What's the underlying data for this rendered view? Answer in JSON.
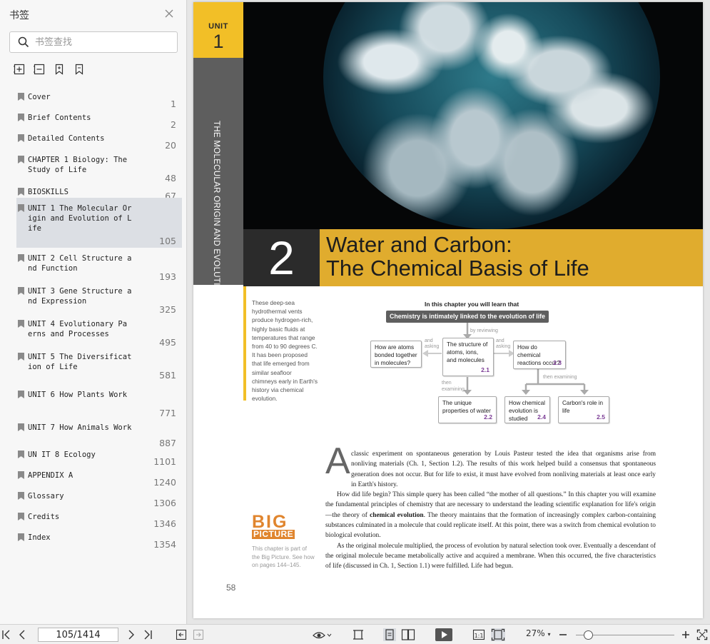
{
  "sidebar": {
    "title": "书签",
    "search_placeholder": "书签查找",
    "bookmarks": [
      {
        "label": "Cover",
        "page": "1"
      },
      {
        "label": "Brief Contents",
        "page": "2"
      },
      {
        "label": "Detailed Contents",
        "page": "20"
      },
      {
        "label": "CHAPTER 1 Biology: The Study of Life",
        "page": "48"
      },
      {
        "label": "BIOSKILLS",
        "page": "67"
      },
      {
        "label": "UNIT 1 The Molecular Origin and Evolution of Life",
        "page": "105"
      },
      {
        "label": "UNIT 2 Cell Structure and Function",
        "page": "193"
      },
      {
        "label": "UNIT 3 Gene Structure and Expression",
        "page": "325"
      },
      {
        "label": "UNIT 4 Evolutionary Pa erns and Processes",
        "page": "495"
      },
      {
        "label": "UNIT 5 The Diversification of Life",
        "page": "581"
      },
      {
        "label": "UNIT 6 How Plants Work",
        "page": "771"
      },
      {
        "label": "UNIT 7 How Animals Work",
        "page": "887"
      },
      {
        "label": "UN IT 8 Ecology",
        "page": "1101"
      },
      {
        "label": "APPENDIX A",
        "page": "1240"
      },
      {
        "label": "Glossary",
        "page": "1306"
      },
      {
        "label": "Credits",
        "page": "1346"
      },
      {
        "label": "Index",
        "page": "1354"
      }
    ]
  },
  "doc": {
    "unit_word": "UNIT",
    "unit_num": "1",
    "unit_strip": "THE MOLECULAR ORIGIN AND EVOLUTION OF LIFE",
    "chapter_num": "2",
    "title_line1": "Water and Carbon:",
    "title_line2": "The Chemical Basis of Life",
    "caption": "These deep-sea hydrothermal vents produce hydrogen-rich, highly basic fluids at temperatures that range from 40 to 90 degrees C. It has been proposed that life emerged from similar seafloor chimneys early in Earth's history via chemical evolution.",
    "concept_map": {
      "heading": "In this chapter you will learn that",
      "main": "Chemistry is intimately linked to the evolution of life",
      "by_reviewing": "by reviewing",
      "and_asking": "and asking",
      "then_examining": "then examining",
      "then": "then",
      "examining": "examining",
      "box_atoms": "How are atoms bonded together in molecules?",
      "box_structure": "The structure of atoms, ions, and molecules",
      "sec_21": "2.1",
      "box_reactions": "How do chemical reactions occur?",
      "sec_23": "2.3",
      "box_water": "The unique properties of water",
      "sec_22": "2.2",
      "box_evolution": "How chemical evolution is studied",
      "sec_24": "2.4",
      "box_carbon": "Carbon's role in life",
      "sec_25": "2.5"
    },
    "big_picture": {
      "big": "BIG",
      "picture": "PICTURE",
      "note": "This chapter is part of the Big Picture. See how on pages 144–145."
    },
    "dropcap": "A",
    "para1": "classic experiment on spontaneous generation by Louis Pasteur tested the idea that organisms arise from nonliving materials (Ch. 1, Section 1.2). The results of this work helped build a consensus that spontaneous generation does not occur. But for life to exist, it must have evolved from nonliving materials at least once early in Earth's history.",
    "para2a": "How did life begin? This simple query has been called “the mother of all questions.” In this chapter you will examine the fundamental principles of chemistry that are necessary to understand the leading scientific explanation for life's origin—the theory of ",
    "para2b": "chemical evolution",
    "para2c": ". The theory maintains that the formation of increasingly complex carbon-containing substances culminated in a molecule that could replicate itself. At this point, there was a switch from chemical evolution to biological evolution.",
    "para3": "As the original molecule multiplied, the process of evolution by natural selection took over. Eventually a descendant of the original molecule became metabolically active and acquired a membrane. When this occurred, the five characteristics of life (discussed in Ch. 1, Section 1.1) were fulfilled. Life had begun.",
    "page_number": "58"
  },
  "bottombar": {
    "page_indicator": "105/1414",
    "zoom": "27%",
    "zoom_level_percent": 27
  },
  "colors": {
    "unit_yellow": "#f2bf27",
    "title_gold": "#e0ac2e",
    "big_picture_orange": "#e0852e",
    "section_purple": "#7a3a94"
  }
}
